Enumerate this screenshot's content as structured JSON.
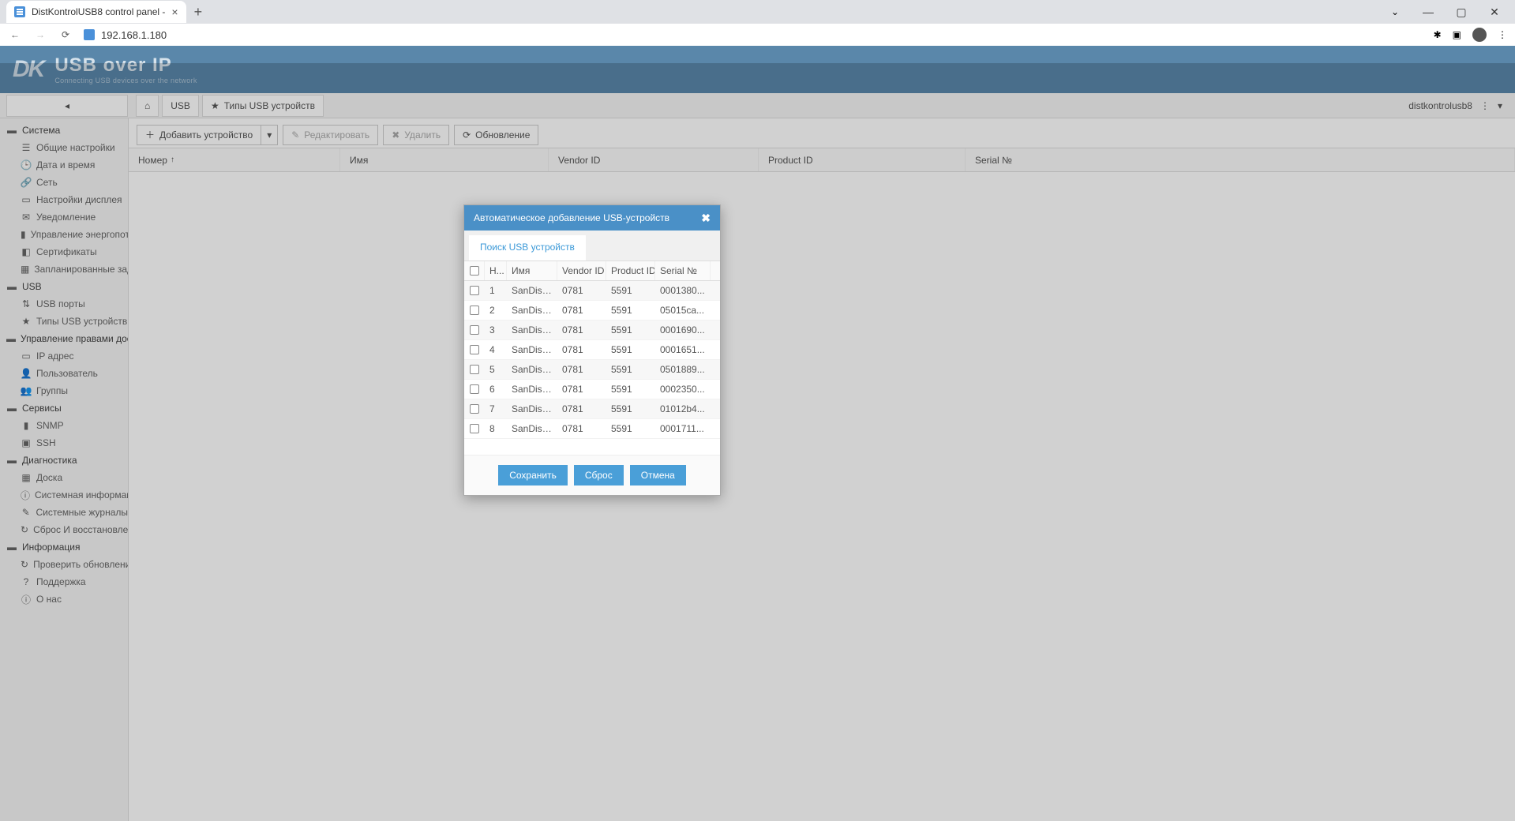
{
  "browser": {
    "tab_title": "DistKontrolUSB8 control panel - ",
    "url": "192.168.1.180"
  },
  "header": {
    "logo_mark": "DK",
    "logo_main": "USB over IP",
    "logo_sub": "Connecting USB devices over the network"
  },
  "breadcrumb": {
    "usb": "USB",
    "types": "Типы USB устройств",
    "user": "distkontrolusb8"
  },
  "sidebar": {
    "system": "Система",
    "system_items": {
      "general": "Общие настройки",
      "datetime": "Дата и время",
      "network": "Сеть",
      "display": "Настройки дисплея",
      "notify": "Уведомление",
      "power": "Управление энергопотр",
      "certs": "Сертификаты",
      "tasks": "Запланированные задан"
    },
    "usb": "USB",
    "usb_items": {
      "ports": "USB порты",
      "types": "Типы USB устройств"
    },
    "access": "Управление правами досту",
    "access_items": {
      "ip": "IP адрес",
      "user": "Пользователь",
      "groups": "Группы"
    },
    "services": "Сервисы",
    "services_items": {
      "snmp": "SNMP",
      "ssh": "SSH"
    },
    "diag": "Диагностика",
    "diag_items": {
      "board": "Доска",
      "sysinfo": "Системная информация",
      "syslog": "Системные журналы",
      "reset": "Сброс И восстановление"
    },
    "info": "Информация",
    "info_items": {
      "updates": "Проверить обновления",
      "support": "Поддержка",
      "about": "О нас"
    }
  },
  "toolbar": {
    "add": "Добавить устройство",
    "edit": "Редактировать",
    "delete": "Удалить",
    "refresh": "Обновление"
  },
  "grid": {
    "col_num": "Номер",
    "col_name": "Имя",
    "col_vid": "Vendor ID",
    "col_pid": "Product ID",
    "col_serial": "Serial №"
  },
  "modal": {
    "title": "Автоматическое добавление USB-устройств",
    "tab": "Поиск USB устройств",
    "col_n": "Н...",
    "col_name": "Имя",
    "col_vid": "Vendor ID",
    "col_pid": "Product ID",
    "col_serial": "Serial №",
    "rows": [
      {
        "n": "1",
        "name": "SanDisk ...",
        "vid": "0781",
        "pid": "5591",
        "serial": "0001380..."
      },
      {
        "n": "2",
        "name": "SanDisk ...",
        "vid": "0781",
        "pid": "5591",
        "serial": "05015ca..."
      },
      {
        "n": "3",
        "name": "SanDisk ...",
        "vid": "0781",
        "pid": "5591",
        "serial": "0001690..."
      },
      {
        "n": "4",
        "name": "SanDisk ...",
        "vid": "0781",
        "pid": "5591",
        "serial": "0001651..."
      },
      {
        "n": "5",
        "name": "SanDisk ...",
        "vid": "0781",
        "pid": "5591",
        "serial": "0501889..."
      },
      {
        "n": "6",
        "name": "SanDisk ...",
        "vid": "0781",
        "pid": "5591",
        "serial": "0002350..."
      },
      {
        "n": "7",
        "name": "SanDisk ...",
        "vid": "0781",
        "pid": "5591",
        "serial": "01012b4..."
      },
      {
        "n": "8",
        "name": "SanDisk ...",
        "vid": "0781",
        "pid": "5591",
        "serial": "0001711..."
      }
    ],
    "save": "Сохранить",
    "reset": "Сброс",
    "cancel": "Отмена"
  }
}
